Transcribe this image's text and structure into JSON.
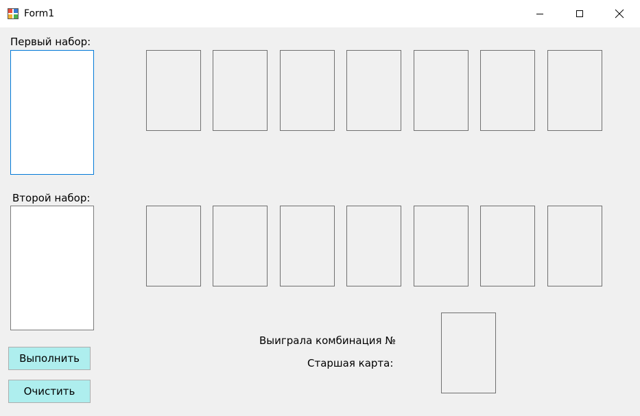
{
  "window": {
    "title": "Form1"
  },
  "labels": {
    "first_set": "Первый набор:",
    "second_set": "Второй набор:",
    "winner": "Выиграла комбинация №",
    "high_card": "Старшая карта:"
  },
  "buttons": {
    "execute": "Выполнить",
    "clear": "Очистить"
  },
  "colors": {
    "form_background": "#f0f0f0",
    "button_background": "#aeeeee",
    "focus_border": "#0078d7"
  },
  "icons": {
    "app": "winforms-app-icon",
    "minimize": "minimize-icon",
    "maximize": "maximize-icon",
    "close": "close-icon"
  }
}
